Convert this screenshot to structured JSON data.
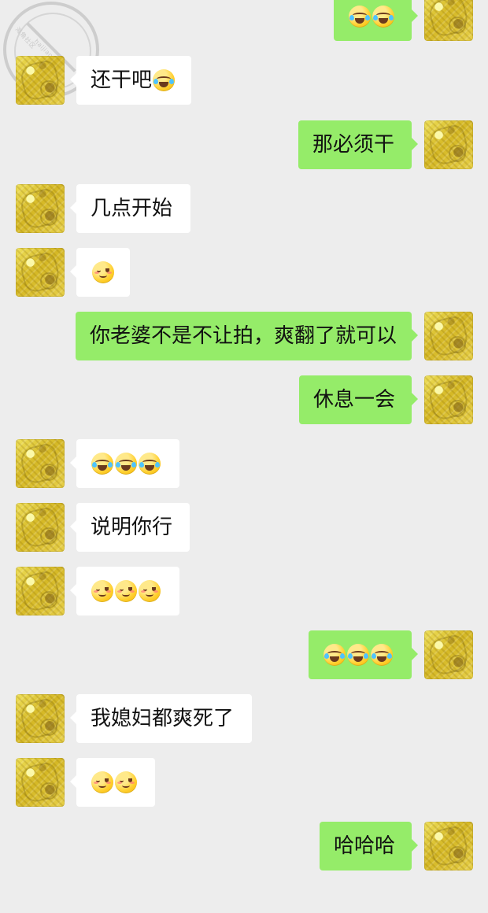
{
  "watermark": {
    "line1": "haijiao.com",
    "line2": "海角社区"
  },
  "messages": [
    {
      "side": "right",
      "avatar": "avatar-me",
      "parts": [
        {
          "type": "emoji",
          "name": "laughing-tears"
        },
        {
          "type": "emoji",
          "name": "laughing-tears"
        }
      ]
    },
    {
      "side": "left",
      "avatar": "avatar-them",
      "parts": [
        {
          "type": "text",
          "value": "还干吧"
        },
        {
          "type": "emoji",
          "name": "laughing-tears"
        }
      ]
    },
    {
      "side": "right",
      "avatar": "avatar-me",
      "parts": [
        {
          "type": "text",
          "value": "那必须干"
        }
      ]
    },
    {
      "side": "left",
      "avatar": "avatar-them",
      "parts": [
        {
          "type": "text",
          "value": "几点开始"
        }
      ]
    },
    {
      "side": "left",
      "avatar": "avatar-them",
      "parts": [
        {
          "type": "emoji",
          "name": "smirking-face"
        }
      ]
    },
    {
      "side": "right",
      "avatar": "avatar-me",
      "parts": [
        {
          "type": "text",
          "value": "你老婆不是不让拍，爽翻了就可以"
        }
      ]
    },
    {
      "side": "right",
      "avatar": "avatar-me",
      "parts": [
        {
          "type": "text",
          "value": "休息一会"
        }
      ]
    },
    {
      "side": "left",
      "avatar": "avatar-them",
      "parts": [
        {
          "type": "emoji",
          "name": "laughing-tears"
        },
        {
          "type": "emoji",
          "name": "laughing-tears"
        },
        {
          "type": "emoji",
          "name": "laughing-tears"
        }
      ]
    },
    {
      "side": "left",
      "avatar": "avatar-them",
      "parts": [
        {
          "type": "text",
          "value": "说明你行"
        }
      ]
    },
    {
      "side": "left",
      "avatar": "avatar-them",
      "parts": [
        {
          "type": "emoji",
          "name": "smirking-face"
        },
        {
          "type": "emoji",
          "name": "smirking-face"
        },
        {
          "type": "emoji",
          "name": "smirking-face"
        }
      ]
    },
    {
      "side": "right",
      "avatar": "avatar-me",
      "parts": [
        {
          "type": "emoji",
          "name": "laughing-tears"
        },
        {
          "type": "emoji",
          "name": "laughing-tears"
        },
        {
          "type": "emoji",
          "name": "laughing-tears"
        }
      ]
    },
    {
      "side": "left",
      "avatar": "avatar-them",
      "parts": [
        {
          "type": "text",
          "value": "我媳妇都爽死了"
        }
      ]
    },
    {
      "side": "left",
      "avatar": "avatar-them",
      "parts": [
        {
          "type": "emoji",
          "name": "smirking-face"
        },
        {
          "type": "emoji",
          "name": "smirking-face"
        }
      ]
    },
    {
      "side": "right",
      "avatar": "avatar-me",
      "parts": [
        {
          "type": "text",
          "value": "哈哈哈"
        }
      ]
    }
  ]
}
